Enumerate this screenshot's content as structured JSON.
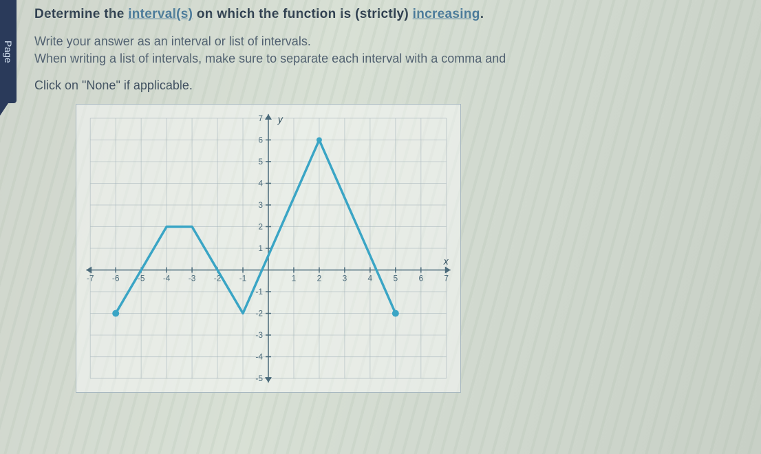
{
  "sidebar": {
    "tab_label": "Page"
  },
  "question": {
    "prefix": "Determine the ",
    "link1": "interval(s)",
    "mid": " on which the function is (strictly) ",
    "link2": "increasing",
    "suffix": "."
  },
  "instruction1": "Write your answer as an interval or list of intervals.",
  "instruction2": "When writing a list of intervals, make sure to separate each interval with a comma and",
  "click_text": "Click on \"None\" if applicable.",
  "chart_data": {
    "type": "line",
    "xlabel": "x",
    "ylabel": "y",
    "xlim": [
      -7,
      7
    ],
    "ylim": [
      -5,
      7
    ],
    "x_ticks": [
      -7,
      -6,
      -5,
      -4,
      -3,
      -2,
      -1,
      1,
      2,
      3,
      4,
      5,
      6,
      7
    ],
    "y_ticks": [
      -5,
      -4,
      -3,
      -2,
      -1,
      1,
      2,
      3,
      4,
      5,
      6,
      7
    ],
    "points": [
      {
        "x": -6,
        "y": -2
      },
      {
        "x": -4,
        "y": 2
      },
      {
        "x": -3,
        "y": 2
      },
      {
        "x": -1,
        "y": -2
      },
      {
        "x": 2,
        "y": 6
      },
      {
        "x": 5,
        "y": -2
      }
    ]
  }
}
